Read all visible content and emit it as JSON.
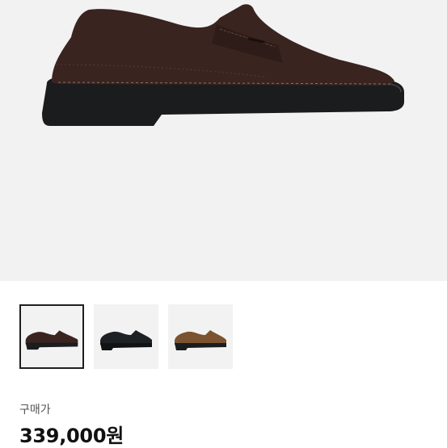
{
  "product": {
    "main_image": {
      "icon": "shoe-photo",
      "color": "#3a2420"
    },
    "thumbnails": [
      {
        "icon": "shoe-photo",
        "color": "#3a2420",
        "selected": true
      },
      {
        "icon": "shoe-photo",
        "color": "#1e2124",
        "selected": false
      },
      {
        "icon": "shoe-photo",
        "color": "#7b5330",
        "selected": false
      }
    ]
  },
  "price": {
    "label": "구매가",
    "value": "339,000원"
  }
}
